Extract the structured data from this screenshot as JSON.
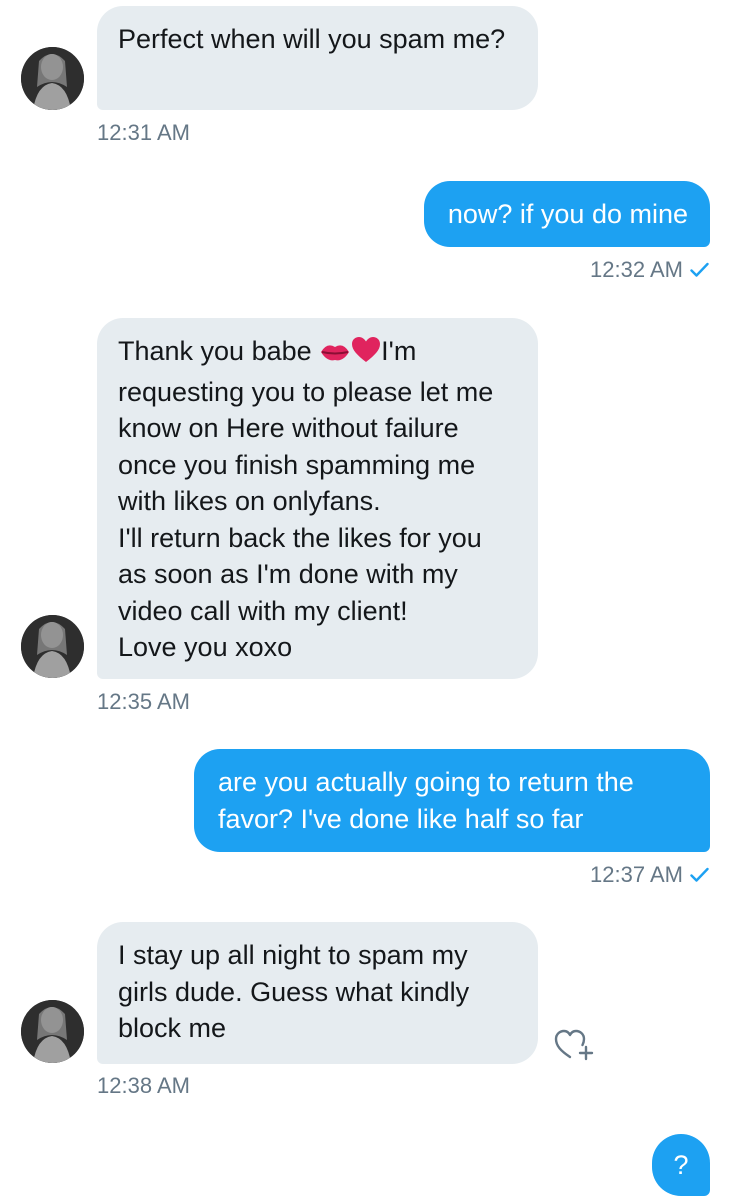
{
  "colors": {
    "incoming_bubble": "#e6ecf0",
    "outgoing_bubble": "#1da1f2",
    "timestamp": "#657786",
    "read_check": "#1da1f2"
  },
  "messages": [
    {
      "direction": "incoming",
      "text": "Perfect when will you spam me?",
      "time": "12:31 AM"
    },
    {
      "direction": "outgoing",
      "text": "now? if you do mine",
      "time": "12:32 AM",
      "status_icon": "checkmark-icon"
    },
    {
      "direction": "incoming",
      "text_before_emoji": "Thank you babe ",
      "emoji": [
        "kiss-lips-emoji",
        "red-heart-emoji"
      ],
      "text": "I'm requesting you to please let me know on Here without failure once you finish spamming me with likes on onlyfans.\nI'll return back the likes for you as soon as I'm done with my video call with my client!\nLove you xoxo",
      "time": "12:35 AM"
    },
    {
      "direction": "outgoing",
      "text": "are you actually going to return the favor? I've done like half so far",
      "time": "12:37 AM",
      "status_icon": "checkmark-icon"
    },
    {
      "direction": "incoming",
      "text": "I stay up all night to spam my girls dude. Guess what kindly block me",
      "time": "12:38 AM",
      "action_icon": "heart-plus-icon"
    },
    {
      "direction": "outgoing",
      "text": "?"
    }
  ]
}
